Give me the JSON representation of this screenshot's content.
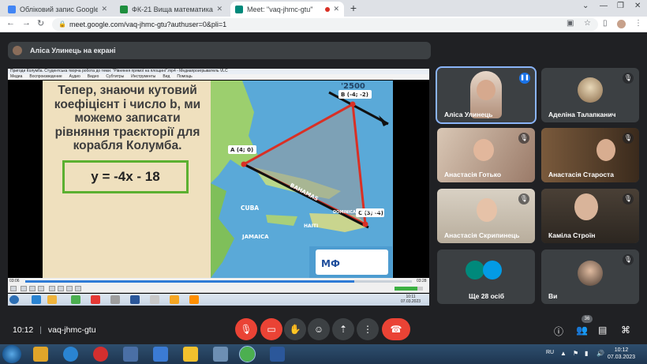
{
  "browser": {
    "tabs": [
      {
        "title": "Обліковий запис Google",
        "favicon_color": "#4285f4"
      },
      {
        "title": "ФК-21 Вища математика",
        "favicon_color": "#1e8e3e"
      },
      {
        "title": "Meet: \"vaq-jhmc-gtu\"",
        "favicon_color": "#00897b"
      }
    ],
    "url": "meet.google.com/vaq-jhmc-gtu?authuser=0&pli=1"
  },
  "presenter": {
    "label": "Аліса Улинець на екрані"
  },
  "vlc": {
    "title": "Пригоди Колумба. Студентська творча робота до теми: \"Рівняння прямої на площині\".mp4 - Медиапроигрыватель VLC",
    "menu": [
      "Медиа",
      "Воспроизведение",
      "Аудио",
      "Видео",
      "Субтитры",
      "Инструменты",
      "Вид",
      "Помощь"
    ],
    "time_elapsed": "03:06",
    "time_total": "03:28",
    "progress_fraction": 0.85,
    "volume_percent": 80
  },
  "slide": {
    "text": "Тепер, знаючи кутовий коефіцієнт і число b, ми можемо записати рівняння траєкторії для корабля Колумба.",
    "equation": "y = -4x - 18",
    "points": [
      {
        "label": "A (4; 0)"
      },
      {
        "label": "B (-4; -2)"
      },
      {
        "label": "C (3; -4)"
      }
    ],
    "map_labels": [
      "BAHAMAS",
      "CUBA",
      "JAMAICA",
      "HAITI",
      "DOMINICAN REPUBLIC"
    ],
    "logo": "МФ"
  },
  "inner_taskbar": {
    "clock_time": "10:11",
    "clock_date": "07.03.2023"
  },
  "participants": [
    {
      "name": "Аліса Улинець",
      "speaking": true
    },
    {
      "name": "Аделіна Талапканич"
    },
    {
      "name": "Анастасія Готько"
    },
    {
      "name": "Анастасія Староста"
    },
    {
      "name": "Анастасія Скрипинець"
    },
    {
      "name": "Каміла Строїн"
    },
    {
      "name": "Ще 28 осіб"
    },
    {
      "name": "Ви"
    }
  ],
  "meet_bar": {
    "time": "10:12",
    "separator": "|",
    "code": "vaq-jhmc-gtu",
    "people_count": "36"
  },
  "taskbar": {
    "lang": "RU",
    "time": "10:12",
    "date": "07.03.2023"
  },
  "colors": {
    "meet_bg": "#202124",
    "tile_bg": "#3c4043",
    "hangup_red": "#ea4335",
    "speaking_blue": "#1a73e8",
    "equation_border": "#5bb030",
    "triangle_red": "#d93025"
  }
}
